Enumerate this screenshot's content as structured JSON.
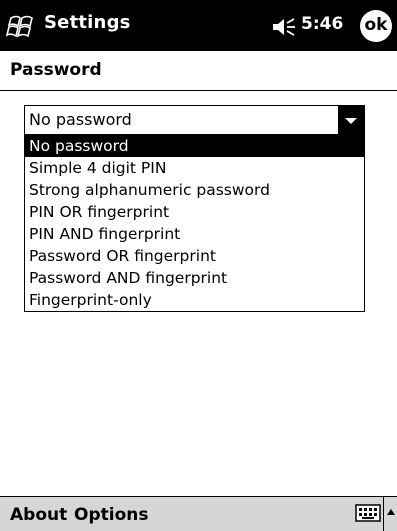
{
  "titlebar": {
    "title": "Settings",
    "time": "5:46",
    "ok_label": "ok"
  },
  "page": {
    "title": "Password"
  },
  "combo": {
    "value": "No password",
    "options": [
      "No password",
      "Simple 4 digit PIN",
      "Strong alphanumeric password",
      "PIN OR fingerprint",
      "PIN AND fingerprint",
      "Password OR fingerprint",
      "Password AND fingerprint",
      "Fingerprint-only"
    ],
    "selected_index": 0
  },
  "menubar": {
    "about_label": "About",
    "options_label": "Options"
  },
  "colors": {
    "titlebar_bg": "#000000",
    "menubar_bg": "#d6d6d6",
    "highlight": "#000000"
  }
}
